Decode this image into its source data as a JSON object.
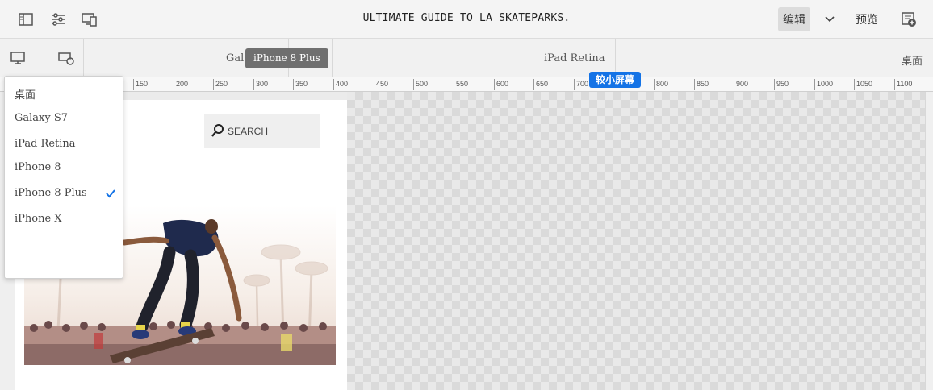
{
  "topbar": {
    "title": "ULTIMATE GUIDE TO LA SKATEPARKS.",
    "edit_label": "编辑",
    "preview_label": "预览",
    "icons": [
      "side-panel-icon",
      "properties-icon",
      "emulator-icon",
      "chevron-down-icon",
      "publish-icon"
    ]
  },
  "devicebar": {
    "devices": [
      {
        "label": "Gal"
      },
      {
        "label": "iPad Retina"
      },
      {
        "label": "桌面"
      }
    ],
    "tooltip": "iPhone 8 Plus",
    "icons": [
      "desktop-icon",
      "device-rotate-icon"
    ]
  },
  "ruler": {
    "ticks": [
      "150",
      "200",
      "250",
      "300",
      "350",
      "400",
      "450",
      "500",
      "550",
      "600",
      "650",
      "700",
      "800",
      "850",
      "900",
      "950",
      "1000",
      "1050",
      "1100"
    ],
    "badge": "较小屏幕"
  },
  "dropdown": {
    "items": [
      {
        "label": "桌面"
      },
      {
        "label": "Galaxy S7"
      },
      {
        "label": "iPad Retina"
      },
      {
        "label": "iPhone 8"
      },
      {
        "label": "iPhone 8 Plus",
        "selected": true
      },
      {
        "label": "iPhone X"
      }
    ]
  },
  "page": {
    "search_label": "SEARCH",
    "hero_alt": "skateboarder"
  },
  "colors": {
    "accent": "#1473e6",
    "tooltip_bg": "#6f6f6f",
    "hero_shirt": "#1f2a4d"
  }
}
